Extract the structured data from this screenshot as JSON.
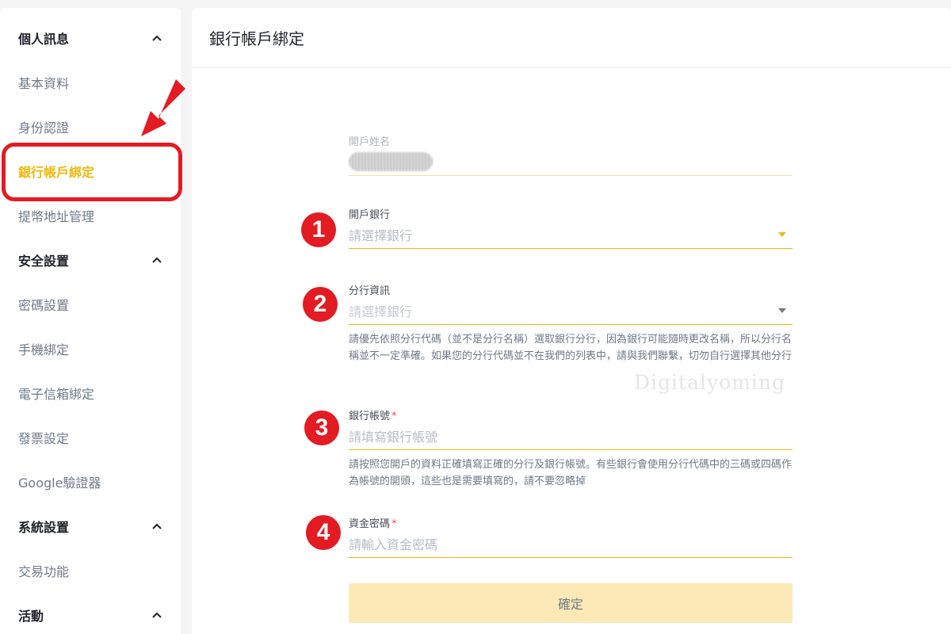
{
  "sidebar": {
    "personal_group": "個人訊息",
    "basic_info": "基本資料",
    "identity_verification": "身份認證",
    "bank_account_binding": "銀行帳戶綁定",
    "withdraw_address": "提幣地址管理",
    "security_group": "安全設置",
    "password_settings": "密碼設置",
    "phone_binding": "手機綁定",
    "email_binding": "電子信箱綁定",
    "invoice_settings": "發票設定",
    "google_authenticator": "Google驗證器",
    "system_group": "系統設置",
    "trading_functions": "交易功能",
    "activity_group": "活動"
  },
  "main": {
    "title": "銀行帳戶綁定",
    "account_name_label": "開戶姓名",
    "bank_label": "開戶銀行",
    "bank_placeholder": "請選擇銀行",
    "branch_label": "分行資訊",
    "branch_placeholder": "請選擇銀行",
    "branch_hint": "請優先依照分行代碼（並不是分行名稱）選取銀行分行，因為銀行可能隨時更改名稱，所以分行名稱並不一定準確。如果您的分行代碼並不在我們的列表中，請與我們聯繫，切勿自行選擇其他分行",
    "account_number_label": "銀行帳號",
    "account_number_placeholder": "請填寫銀行帳號",
    "account_number_hint": "請按照您開戶的資料正確填寫正確的分行及銀行帳號。有些銀行會使用分行代碼中的三碼或四碼作為帳號的開頭，這些也是需要填寫的，請不要忽略掉",
    "fund_password_label": "資金密碼",
    "fund_password_placeholder": "請輸入資金密碼",
    "required_mark": "*",
    "confirm_button": "確定"
  },
  "annotations": {
    "step1": "1",
    "step2": "2",
    "step3": "3",
    "step4": "4",
    "watermark": "Digitalyoming"
  },
  "colors": {
    "accent": "#f0b90b",
    "annotation_red": "#e31b23",
    "button_bg": "#fce9b5"
  },
  "icons": [
    "chevron-up-icon",
    "dropdown-caret-icon",
    "red-arrow-icon"
  ]
}
